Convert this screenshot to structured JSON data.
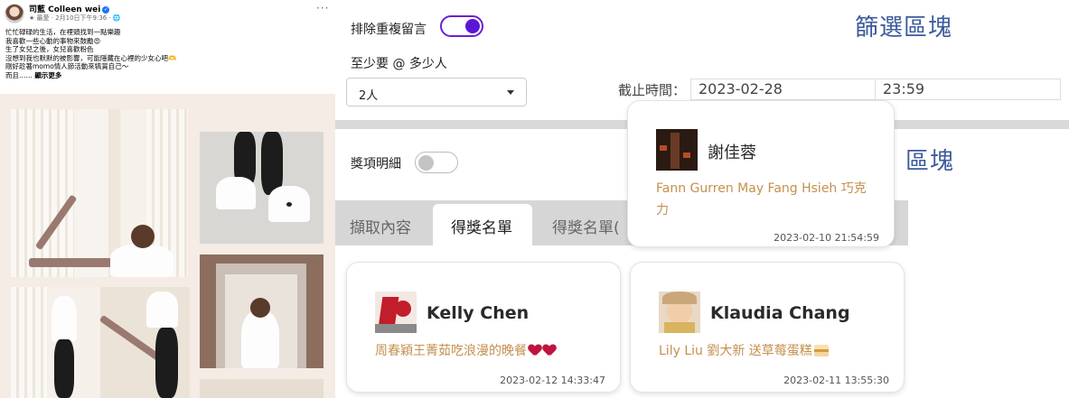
{
  "fb_post": {
    "author": "司藍 Colleen wei",
    "meta": "★ 最愛 · 2月10日下午9:36 · 🌐",
    "more": "···",
    "lines": [
      "忙忙碌碌的生活，在裡頭找到一點樂趣",
      "我喜歡一些心動的事物來鼓勵😍",
      "生了女兒之後，女兒喜歡粉色",
      "沒想到我也默默的被影響，可能隱藏在心裡的少女心吧🫶",
      "剛好趁著momo情人節活動來犒賞自己～",
      "而且……"
    ],
    "see_more": "顯示更多"
  },
  "filter_block": {
    "exclude_dup_label": "排除重複留言",
    "min_count_label": "至少要 @ 多少人",
    "min_count_value": "2人",
    "title": "篩選區塊",
    "deadline_label": "截止時間：",
    "deadline_date": "2023-02-28",
    "deadline_time": "23:59"
  },
  "prize_block": {
    "detail_label": "獎項明細",
    "title": "區塊"
  },
  "tabs": [
    "擷取內容",
    "得獎名單",
    "得獎名單("
  ],
  "winners": [
    {
      "name": "謝佳蓉",
      "message": "Fann Gurren May Fang Hsieh 巧克力",
      "time": "2023-02-10 21:54:59"
    },
    {
      "name": "Kelly Chen",
      "message": "周春穎王菁茹吃浪漫的晚餐",
      "time": "2023-02-12 14:33:47"
    },
    {
      "name": "Klaudia Chang",
      "message": "Lily Liu 劉大新 送草莓蛋糕",
      "time": "2023-02-11 13:55:30"
    }
  ],
  "colors": {
    "accent": "#5a17d6",
    "title": "#3d5a9a",
    "message": "#c4904e"
  }
}
